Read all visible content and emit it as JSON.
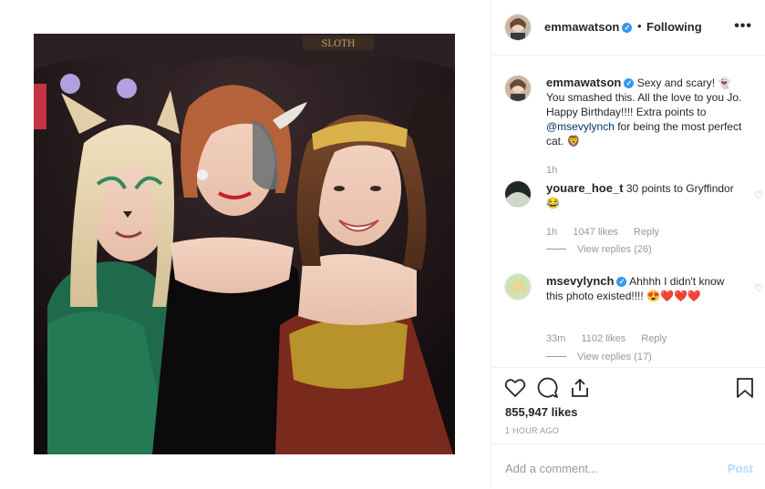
{
  "post": {
    "username": "emmawatson",
    "following_label": "Following",
    "separator": "•",
    "more_label": "•••"
  },
  "caption": {
    "username": "emmawatson",
    "text_before_mention": "Sexy and scary! 👻 You smashed this. All the love to you Jo. Happy Birthday!!!! Extra points to ",
    "mention": "@msevylynch",
    "text_after_mention": " for being the most perfect cat. 🦁",
    "age": "1h"
  },
  "comments": [
    {
      "username": "youare_hoe_t",
      "text": " 30 points to Gryffindor😂",
      "age": "1h",
      "likes": "1047 likes",
      "reply_label": "Reply",
      "view_replies": "View replies (26)"
    },
    {
      "username": "msevylynch",
      "text": " Ahhhh I didn't know this photo existed!!!! 😍❤️❤️❤️",
      "age": "33m",
      "likes": "1102 likes",
      "reply_label": "Reply",
      "view_replies": "View replies (17)"
    }
  ],
  "actions": {
    "likes_count": "855,947 likes",
    "timestamp": "1 HOUR AGO"
  },
  "add_comment": {
    "placeholder": "Add a comment...",
    "post_label": "Post"
  },
  "icons": {
    "like": "heart-icon",
    "comment": "comment-bubble-icon",
    "share": "share-icon",
    "save": "bookmark-icon",
    "verified": "verified-badge-icon",
    "comment_like": "small-heart-icon"
  },
  "colors": {
    "verified": "#3897f0",
    "text": "#262626",
    "muted": "#999999",
    "mention": "#003569",
    "post_disabled": "#b3dbff"
  }
}
